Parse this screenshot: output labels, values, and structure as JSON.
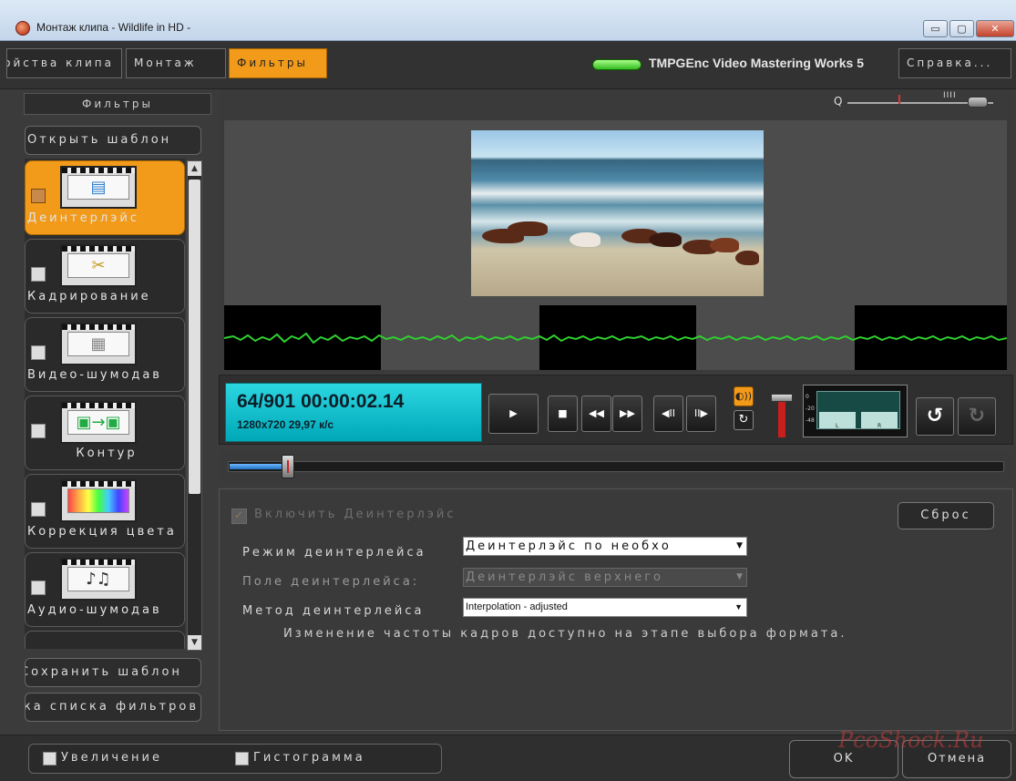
{
  "window": {
    "title": "Монтаж клипа - Wildlife in HD -",
    "min_symbol": "▭",
    "max_symbol": "▢",
    "close_symbol": "✕"
  },
  "topbar": {
    "tabs": [
      {
        "label": "Свойства клипа"
      },
      {
        "label": "Монтаж"
      },
      {
        "label": "Фильтры"
      }
    ],
    "product_name": "TMPGEnc Video Mastering Works 5",
    "help_label": "Справка..."
  },
  "left_panel": {
    "header": "Фильтры",
    "open_template": "Открыть шаблон",
    "filters": [
      {
        "label": "Деинтерлэйс",
        "selected": true,
        "icon": "deinterlace-icon"
      },
      {
        "label": "Кадрирование",
        "selected": false,
        "icon": "crop-icon"
      },
      {
        "label": "Видео-шумодав",
        "selected": false,
        "icon": "video-denoise-icon"
      },
      {
        "label": "Контур",
        "selected": false,
        "icon": "contour-icon"
      },
      {
        "label": "Коррекция цвета",
        "selected": false,
        "icon": "color-correction-icon"
      },
      {
        "label": "Аудио-шумодав",
        "selected": false,
        "icon": "audio-denoise-icon"
      }
    ],
    "save_template": "Сохранить шаблон",
    "filter_list_settings": "Настройка списка фильтров"
  },
  "transport": {
    "frames_and_time": "64/901  00:00:02.14",
    "format_info": "1280x720 29,97 к/с",
    "play_symbol": "▶",
    "stop_symbol": "■",
    "rewind_symbol": "◀◀",
    "ff_symbol": "▶▶",
    "stepback_symbol": "◀II",
    "stepfwd_symbol": "II▶",
    "audio_symbol": "◐))",
    "loop_symbol": "↻",
    "undo_symbol": "↺",
    "redo_symbol": "↻",
    "meter_left": "L",
    "meter_right": "R",
    "meter_scale": [
      "0",
      "-20",
      "-48"
    ]
  },
  "timeline": {
    "position": 64,
    "total": 901
  },
  "settings": {
    "enable_label": "Включить Деинтерлэйс",
    "reset_label": "Сброс",
    "mode_label": "Режим деинтерлейса",
    "mode_value": "Деинтерлэйс по необхо",
    "field_label": "Поле деинтерлейса:",
    "field_value": "Деинтерлэйс верхнего",
    "method_label": "Метод деинтерлейса",
    "method_value": "Interpolation - adjusted",
    "dropdown_arrow": "▼",
    "info_text": "Изменение частоты кадров доступно на этапе выбора формата."
  },
  "bottom": {
    "zoom_label": "Увеличение",
    "histogram_label": "Гистограмма",
    "ok_label": "OK",
    "cancel_label": "Отмена"
  },
  "watermark": "PcoShock.Ru",
  "colors": {
    "accent": "#f29a1a",
    "timecode_bg": "#1cc4d0",
    "waveform": "#2fd02f"
  }
}
